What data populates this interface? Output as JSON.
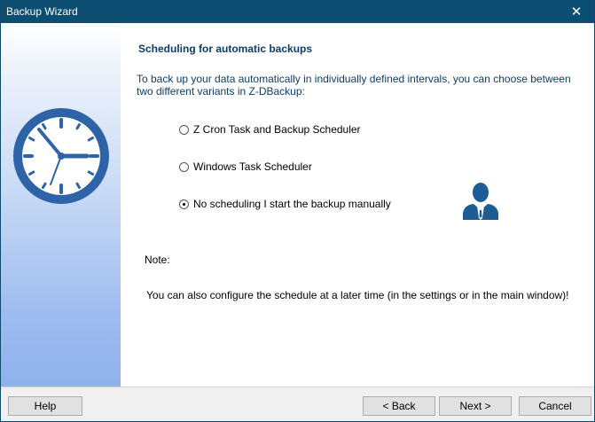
{
  "window": {
    "title": "Backup Wizard",
    "close_glyph": "✕"
  },
  "content": {
    "heading": "Scheduling for automatic backups",
    "intro": "To back up your data automatically in individually defined intervals, you can choose between two different variants in Z-DBackup:",
    "options": [
      {
        "label": "Z Cron Task and Backup Scheduler",
        "selected": false
      },
      {
        "label": "Windows Task Scheduler",
        "selected": false
      },
      {
        "label": "No scheduling I start the backup manually",
        "selected": true
      }
    ],
    "note_label": "Note:",
    "note_text": "You can also configure the schedule at a later time (in the settings or in the main window)!"
  },
  "buttons": {
    "help": "Help",
    "back": "< Back",
    "next": "Next >",
    "cancel": "Cancel"
  },
  "icons": {
    "sidebar": "clock-icon",
    "user": "user-icon",
    "close": "close-icon"
  },
  "colors": {
    "titlebar": "#0c4d72",
    "heading": "#0c3c6a",
    "clock": "#2f63a8",
    "user": "#1e5c93"
  }
}
